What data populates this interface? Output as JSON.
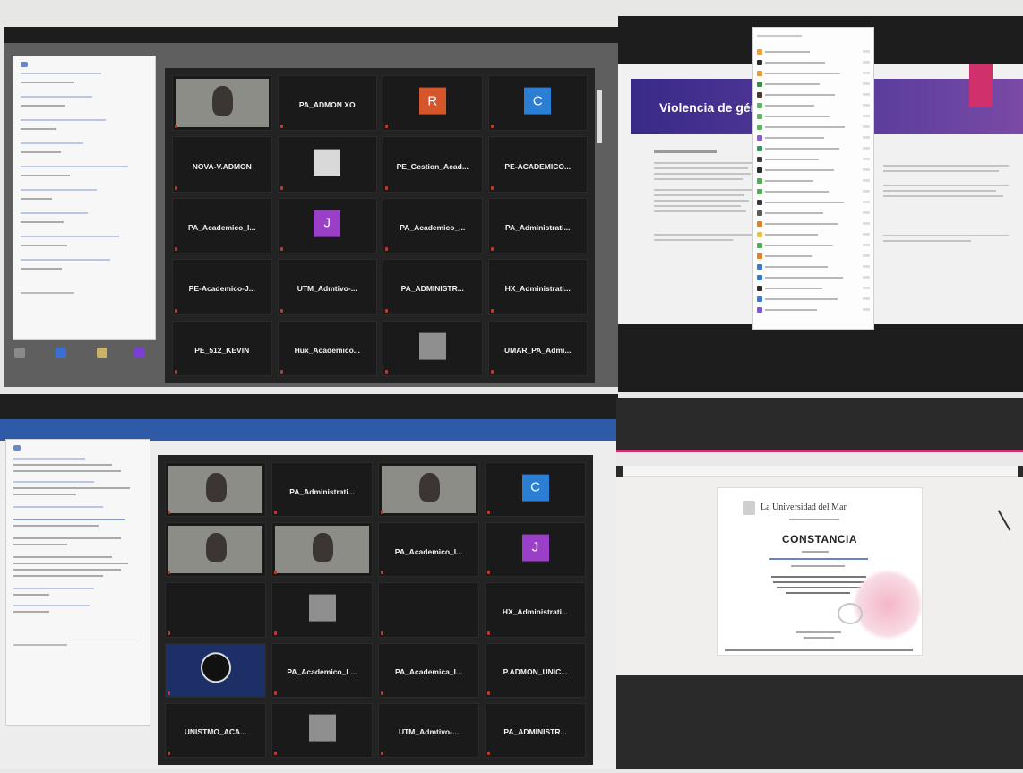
{
  "panel1": {
    "tiles": [
      {
        "name": "",
        "sub": "",
        "kind": "video"
      },
      {
        "name": "PA_ADMON XO",
        "sub": "",
        "kind": "name"
      },
      {
        "name": "",
        "sub": "",
        "kind": "avatar",
        "letter": "R",
        "color": "#d6562b"
      },
      {
        "name": "",
        "sub": "",
        "kind": "avatar",
        "letter": "C",
        "color": "#2a7fd4"
      },
      {
        "name": "NOVA-V.ADMON",
        "sub": "",
        "kind": "name"
      },
      {
        "name": "",
        "sub": "",
        "kind": "logo"
      },
      {
        "name": "PE_Gestion_Acad...",
        "sub": "",
        "kind": "name"
      },
      {
        "name": "PE-ACADEMICO...",
        "sub": "",
        "kind": "name"
      },
      {
        "name": "PA_Academico_I...",
        "sub": "",
        "kind": "name"
      },
      {
        "name": "",
        "sub": "",
        "kind": "avatar",
        "letter": "J",
        "color": "#9a3fc7"
      },
      {
        "name": "PA_Academico_...",
        "sub": "",
        "kind": "name"
      },
      {
        "name": "PA_Administrati...",
        "sub": "",
        "kind": "name"
      },
      {
        "name": "PE-Academico-J...",
        "sub": "",
        "kind": "name"
      },
      {
        "name": "UTM_Admtivo-...",
        "sub": "",
        "kind": "name"
      },
      {
        "name": "PA_ADMINISTR...",
        "sub": "",
        "kind": "name"
      },
      {
        "name": "HX_Administrati...",
        "sub": "",
        "kind": "name"
      },
      {
        "name": "PE_512_KEVIN",
        "sub": "",
        "kind": "name"
      },
      {
        "name": "Hux_Academico...",
        "sub": "",
        "kind": "name"
      },
      {
        "name": "",
        "sub": "",
        "kind": "photo"
      },
      {
        "name": "UMAR_PA_Admi...",
        "sub": "",
        "kind": "name"
      }
    ]
  },
  "panel2": {
    "slide_title": "Violencia de gén"
  },
  "panel3": {
    "tiles": [
      {
        "name": "",
        "sub": "",
        "kind": "video"
      },
      {
        "name": "PA_Administrati...",
        "sub": "",
        "kind": "name"
      },
      {
        "name": "",
        "sub": "",
        "kind": "video"
      },
      {
        "name": "",
        "sub": "",
        "kind": "avatar",
        "letter": "C",
        "color": "#2a7fd4"
      },
      {
        "name": "",
        "sub": "",
        "kind": "video"
      },
      {
        "name": "",
        "sub": "",
        "kind": "video"
      },
      {
        "name": "PA_Academico_I...",
        "sub": "",
        "kind": "name"
      },
      {
        "name": "",
        "sub": "",
        "kind": "avatar",
        "letter": "J",
        "color": "#9a3fc7"
      },
      {
        "name": "",
        "sub": "",
        "kind": "empty"
      },
      {
        "name": "",
        "sub": "",
        "kind": "photo"
      },
      {
        "name": "",
        "sub": "",
        "kind": "empty"
      },
      {
        "name": "HX_Administrati...",
        "sub": "",
        "kind": "name"
      },
      {
        "name": "",
        "sub": "",
        "kind": "obs"
      },
      {
        "name": "PA_Academico_L...",
        "sub": "",
        "kind": "name"
      },
      {
        "name": "PA_Academica_I...",
        "sub": "",
        "kind": "name"
      },
      {
        "name": "P.ADMON_UNIC...",
        "sub": "",
        "kind": "name"
      },
      {
        "name": "UNISTMO_ACA...",
        "sub": "",
        "kind": "name"
      },
      {
        "name": "",
        "sub": "",
        "kind": "photo"
      },
      {
        "name": "UTM_Admtivo-...",
        "sub": "",
        "kind": "name"
      },
      {
        "name": "PA_ADMINISTR...",
        "sub": "",
        "kind": "name"
      }
    ]
  },
  "panel4": {
    "university": "La Universidad del Mar",
    "heading": "CONSTANCIA"
  },
  "colors": {
    "slide_purple": "#4a2f8e",
    "slide_pink": "#d0306c",
    "zoom_bg": "#232323",
    "word_blue": "#2f5aa8"
  },
  "icons": {
    "chat": "chat-bubble-icon",
    "mic": "muted-mic-icon",
    "desktop": "desktop-app-icon"
  }
}
